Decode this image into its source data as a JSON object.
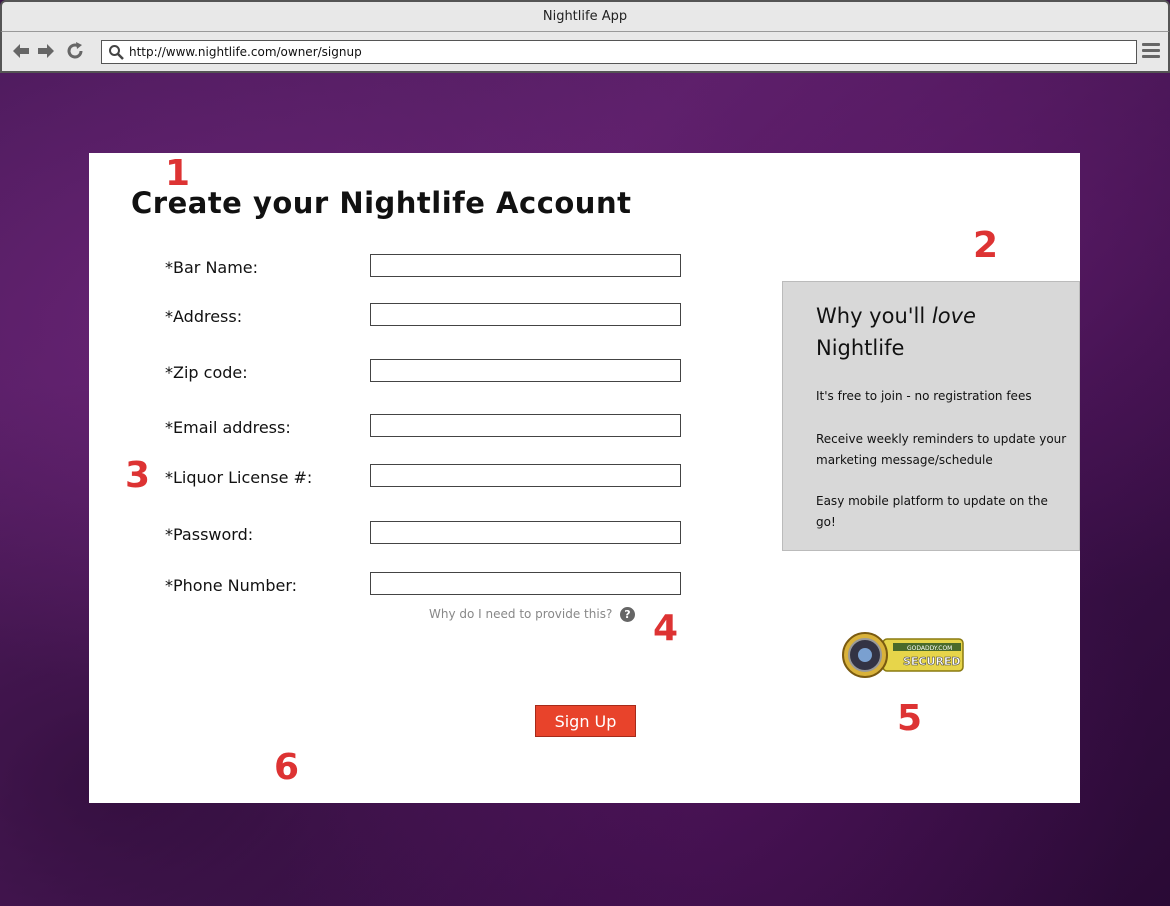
{
  "window": {
    "title": "Nightlife App"
  },
  "browser": {
    "url": "http://www.nightlife.com/owner/signup",
    "back_icon": "arrow-left-icon",
    "forward_icon": "arrow-right-icon",
    "reload_icon": "reload-icon",
    "menu_icon": "hamburger-menu-icon"
  },
  "page": {
    "title": "Create your Nightlife Account",
    "fields": [
      {
        "label": "*Bar Name:",
        "value": ""
      },
      {
        "label": "*Address:",
        "value": ""
      },
      {
        "label": "*Zip code:",
        "value": ""
      },
      {
        "label": "*Email address:",
        "value": ""
      },
      {
        "label": "*Liquor License #:",
        "value": ""
      },
      {
        "label": "*Password:",
        "value": ""
      },
      {
        "label": "*Phone Number:",
        "value": ""
      }
    ],
    "help_text": "Why do I need to provide this?",
    "help_icon": "?",
    "signup_label": "Sign Up"
  },
  "sidebar": {
    "title_prefix": "Why you'll",
    "title_emphasis": "love",
    "title_suffix": "Nightlife",
    "items": [
      "It's free to join - no registration fees",
      "Receive weekly reminders to update your marketing message/schedule",
      "Easy mobile platform to update on the go!"
    ]
  },
  "seal": {
    "text": "SECURED",
    "small_text": "GODADDY.COM"
  },
  "annotations": [
    "1",
    "2",
    "3",
    "4",
    "5",
    "6"
  ],
  "colors": {
    "accent": "#e8432b",
    "annotation": "#d33333",
    "sidebar_bg": "#d8d8d8"
  }
}
